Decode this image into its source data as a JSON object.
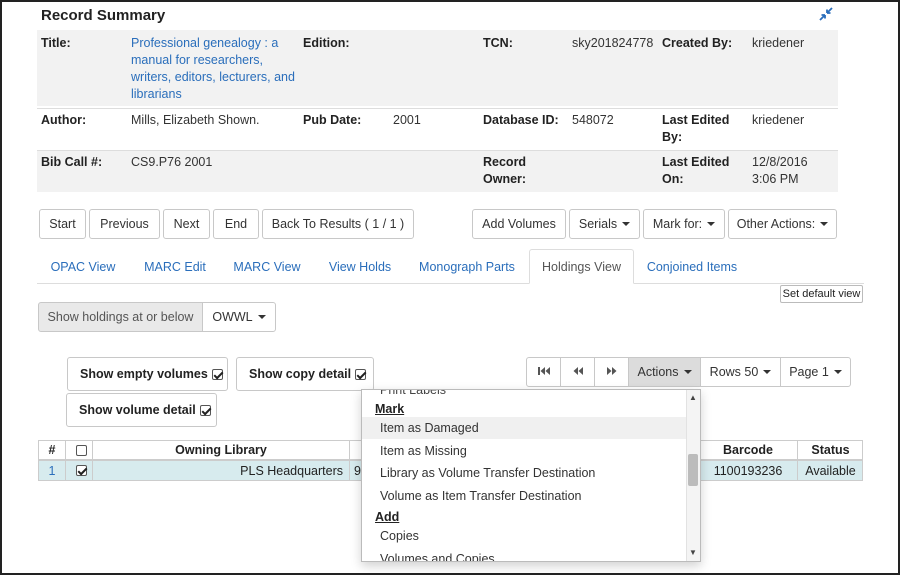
{
  "summary": {
    "heading": "Record Summary",
    "rows": [
      {
        "title_label": "Title:",
        "title_value": "Professional genealogy : a manual for researchers, writers, editors, lecturers, and librarians",
        "edition_label": "Edition:",
        "edition_value": "",
        "tcn_label": "TCN:",
        "tcn_value": "sky201824778",
        "created_by_label": "Created By:",
        "created_by_value": "kriedener"
      },
      {
        "author_label": "Author:",
        "author_value": "Mills, Elizabeth Shown.",
        "pub_date_label": "Pub Date:",
        "pub_date_value": "2001",
        "database_id_label": "Database ID:",
        "database_id_value": "548072",
        "last_edited_by_label": "Last Edited By:",
        "last_edited_by_value": "kriedener"
      },
      {
        "bib_call_label": "Bib Call #:",
        "bib_call_value": "CS9.P76 2001",
        "record_owner_label": "Record Owner:",
        "record_owner_value": "",
        "last_edited_on_label": "Last Edited On:",
        "last_edited_on_value": "12/8/2016 3:06 PM"
      }
    ]
  },
  "nav_buttons": {
    "start": "Start",
    "previous": "Previous",
    "next": "Next",
    "end": "End",
    "back_to_results": "Back To Results ( 1 / 1 )",
    "add_volumes": "Add Volumes",
    "serials": "Serials",
    "mark_for": "Mark for:",
    "other_actions": "Other Actions:"
  },
  "tabs": [
    {
      "label": "OPAC View",
      "active": false
    },
    {
      "label": "MARC Edit",
      "active": false
    },
    {
      "label": "MARC View",
      "active": false
    },
    {
      "label": "View Holds",
      "active": false
    },
    {
      "label": "Monograph Parts",
      "active": false
    },
    {
      "label": "Holdings View",
      "active": true
    },
    {
      "label": "Conjoined Items",
      "active": false
    }
  ],
  "set_default_view": "Set default view",
  "holdings_filter": {
    "label": "Show holdings at or below",
    "org": "OWWL"
  },
  "options": {
    "show_empty_volumes": {
      "label": "Show empty volumes",
      "checked": true
    },
    "show_copy_detail": {
      "label": "Show copy detail",
      "checked": true
    },
    "show_volume_detail": {
      "label": "Show volume detail",
      "checked": true
    }
  },
  "pager": {
    "actions": "Actions",
    "rows": "Rows 50",
    "page": "Page 1"
  },
  "grid": {
    "columns": {
      "index": "#",
      "owning_library": "Owning Library",
      "barcode": "Barcode",
      "status": "Status"
    },
    "rows": [
      {
        "index": "1",
        "selected": true,
        "owning_library": "PLS Headquarters",
        "call_partial": "9",
        "barcode": "1100193236",
        "status": "Available"
      }
    ]
  },
  "actions_menu": {
    "partial_top_item": "Print Labels",
    "groups": [
      {
        "label": "Mark",
        "items": [
          "Item as Damaged",
          "Item as Missing",
          "Library as Volume Transfer Destination",
          "Volume as Item Transfer Destination"
        ]
      },
      {
        "label": "Add",
        "items": [
          "Copies",
          "Volumes and Copies"
        ]
      }
    ],
    "hovered_item": "Item as Damaged"
  },
  "icons": {
    "collapse": "collapse-arrows-icon",
    "first_page": "first-page-icon",
    "prev_page": "prev-page-icon",
    "next_page": "next-page-icon"
  },
  "colors": {
    "link": "#2a6ebb",
    "summary_stripe": "#f2f2f2",
    "selected_row": "#d7ebee",
    "active_button": "#dcdcdc"
  }
}
